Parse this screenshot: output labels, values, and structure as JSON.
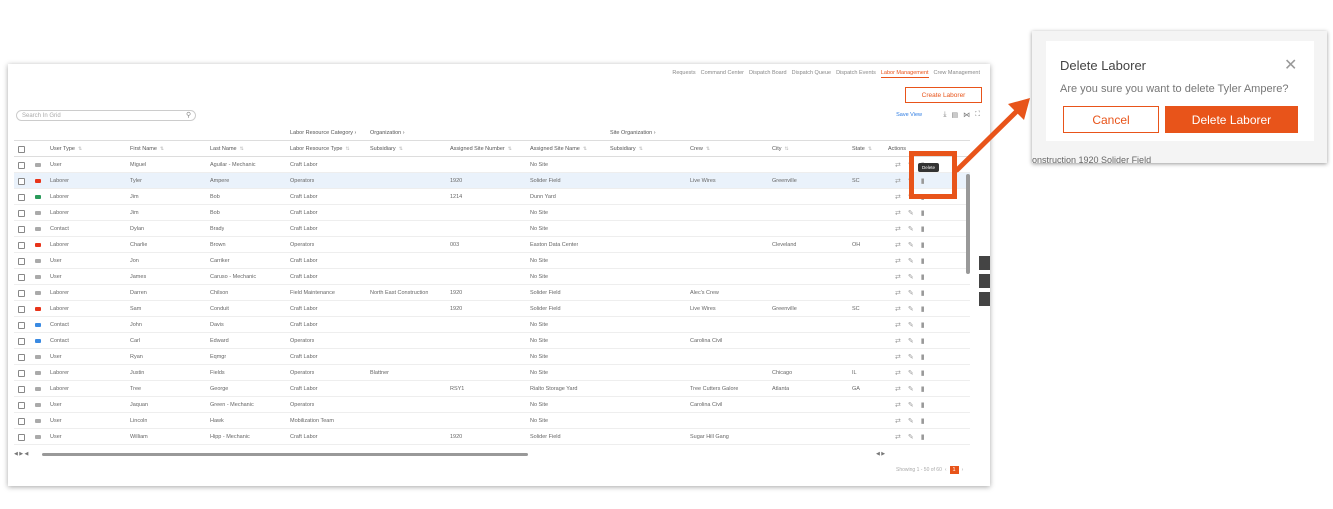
{
  "nav": [
    "Requests",
    "Command Center",
    "Dispatch Board",
    "Dispatch Queue",
    "Dispatch Events",
    "Labor Management",
    "Crew Management"
  ],
  "nav_active": "Labor Management",
  "create_button": "Create Laborer",
  "search_placeholder": "Search In Grid",
  "save_view": "Save View",
  "group_headers": {
    "labor_resource_category": "Labor Resource Category",
    "organization": "Organization",
    "site_organization": "Site Organization"
  },
  "columns": [
    "User Type",
    "First Name",
    "Last Name",
    "Labor Resource Type",
    "Subsidiary",
    "Assigned Site Number",
    "Assigned Site Name",
    "Subsidiary",
    "Crew",
    "City",
    "State",
    "Actions"
  ],
  "tag_colors": {
    "user": "#aaaaaa",
    "laborer_red": "#e8341a",
    "laborer_green": "#2a9a5a",
    "contact": "#3a8ae2"
  },
  "rows": [
    {
      "tag": "user",
      "type": "User",
      "first": "Miguel",
      "last": "Aguilar - Mechanic",
      "res": "Craft Labor",
      "sub": "",
      "site_no": "",
      "site_name": "No Site",
      "sub2": "",
      "crew": "",
      "city": "",
      "state": ""
    },
    {
      "tag": "laborer_red",
      "type": "Laborer",
      "first": "Tyler",
      "last": "Ampere",
      "res": "Operators",
      "sub": "",
      "site_no": "1920",
      "site_name": "Solider Field",
      "sub2": "",
      "crew": "Live Wires",
      "city": "Greenville",
      "state": "SC"
    },
    {
      "tag": "laborer_green",
      "type": "Laborer",
      "first": "Jim",
      "last": "Bob",
      "res": "Craft Labor",
      "sub": "",
      "site_no": "1214",
      "site_name": "Dunn Yard",
      "sub2": "",
      "crew": "",
      "city": "",
      "state": ""
    },
    {
      "tag": "user",
      "type": "Laborer",
      "first": "Jim",
      "last": "Bob",
      "res": "Craft Labor",
      "sub": "",
      "site_no": "",
      "site_name": "No Site",
      "sub2": "",
      "crew": "",
      "city": "",
      "state": ""
    },
    {
      "tag": "user",
      "type": "Contact",
      "first": "Dylan",
      "last": "Brady",
      "res": "Craft Labor",
      "sub": "",
      "site_no": "",
      "site_name": "No Site",
      "sub2": "",
      "crew": "",
      "city": "",
      "state": ""
    },
    {
      "tag": "laborer_red",
      "type": "Laborer",
      "first": "Charlie",
      "last": "Brown",
      "res": "Operators",
      "sub": "",
      "site_no": "003",
      "site_name": "Easton Data Center",
      "sub2": "",
      "crew": "",
      "city": "Cleveland",
      "state": "OH"
    },
    {
      "tag": "user",
      "type": "User",
      "first": "Jon",
      "last": "Carriker",
      "res": "Craft Labor",
      "sub": "",
      "site_no": "",
      "site_name": "No Site",
      "sub2": "",
      "crew": "",
      "city": "",
      "state": ""
    },
    {
      "tag": "user",
      "type": "User",
      "first": "James",
      "last": "Caruso - Mechanic",
      "res": "Craft Labor",
      "sub": "",
      "site_no": "",
      "site_name": "No Site",
      "sub2": "",
      "crew": "",
      "city": "",
      "state": ""
    },
    {
      "tag": "user",
      "type": "Laborer",
      "first": "Darren",
      "last": "Chilson",
      "res": "Field Maintenance",
      "sub": "North East Construction",
      "site_no": "1920",
      "site_name": "Solider Field",
      "sub2": "",
      "crew": "Alec's Crew",
      "city": "",
      "state": ""
    },
    {
      "tag": "laborer_red",
      "type": "Laborer",
      "first": "Sam",
      "last": "Conduit",
      "res": "Craft Labor",
      "sub": "",
      "site_no": "1920",
      "site_name": "Solider Field",
      "sub2": "",
      "crew": "Live Wires",
      "city": "Greenville",
      "state": "SC"
    },
    {
      "tag": "contact",
      "type": "Contact",
      "first": "John",
      "last": "Davis",
      "res": "Craft Labor",
      "sub": "",
      "site_no": "",
      "site_name": "No Site",
      "sub2": "",
      "crew": "",
      "city": "",
      "state": ""
    },
    {
      "tag": "contact",
      "type": "Contact",
      "first": "Carl",
      "last": "Edward",
      "res": "Operators",
      "sub": "",
      "site_no": "",
      "site_name": "No Site",
      "sub2": "",
      "crew": "Carolina Civil",
      "city": "",
      "state": ""
    },
    {
      "tag": "user",
      "type": "User",
      "first": "Ryan",
      "last": "Eqmgr",
      "res": "Craft Labor",
      "sub": "",
      "site_no": "",
      "site_name": "No Site",
      "sub2": "",
      "crew": "",
      "city": "",
      "state": ""
    },
    {
      "tag": "user",
      "type": "Laborer",
      "first": "Justin",
      "last": "Fields",
      "res": "Operators",
      "sub": "Blattner",
      "site_no": "",
      "site_name": "No Site",
      "sub2": "",
      "crew": "",
      "city": "Chicago",
      "state": "IL"
    },
    {
      "tag": "user",
      "type": "Laborer",
      "first": "Tree",
      "last": "George",
      "res": "Craft Labor",
      "sub": "",
      "site_no": "RSY1",
      "site_name": "Rialto Storage Yard",
      "sub2": "",
      "crew": "Tree Cutters Galore",
      "city": "Atlanta",
      "state": "GA"
    },
    {
      "tag": "user",
      "type": "User",
      "first": "Jaquan",
      "last": "Green - Mechanic",
      "res": "Operators",
      "sub": "",
      "site_no": "",
      "site_name": "No Site",
      "sub2": "",
      "crew": "Carolina Civil",
      "city": "",
      "state": ""
    },
    {
      "tag": "user",
      "type": "User",
      "first": "Lincoln",
      "last": "Hawk",
      "res": "Mobilization Team",
      "sub": "",
      "site_no": "",
      "site_name": "No Site",
      "sub2": "",
      "crew": "",
      "city": "",
      "state": ""
    },
    {
      "tag": "user",
      "type": "User",
      "first": "William",
      "last": "Hipp - Mechanic",
      "res": "Craft Labor",
      "sub": "",
      "site_no": "1920",
      "site_name": "Solider Field",
      "sub2": "",
      "crew": "Sugar Hill Gang",
      "city": "",
      "state": ""
    }
  ],
  "highlighted_row": 1,
  "tooltip": "Delete",
  "footer": {
    "showing": "Showing 1 - 50 of 60",
    "page": "1"
  },
  "dialog": {
    "title": "Delete Laborer",
    "message": "Are you sure you want to delete Tyler Ampere?",
    "cancel": "Cancel",
    "confirm": "Delete Laborer",
    "behind_text": "onstruction      1920                         Solider Field"
  },
  "accent": "#e8541a"
}
